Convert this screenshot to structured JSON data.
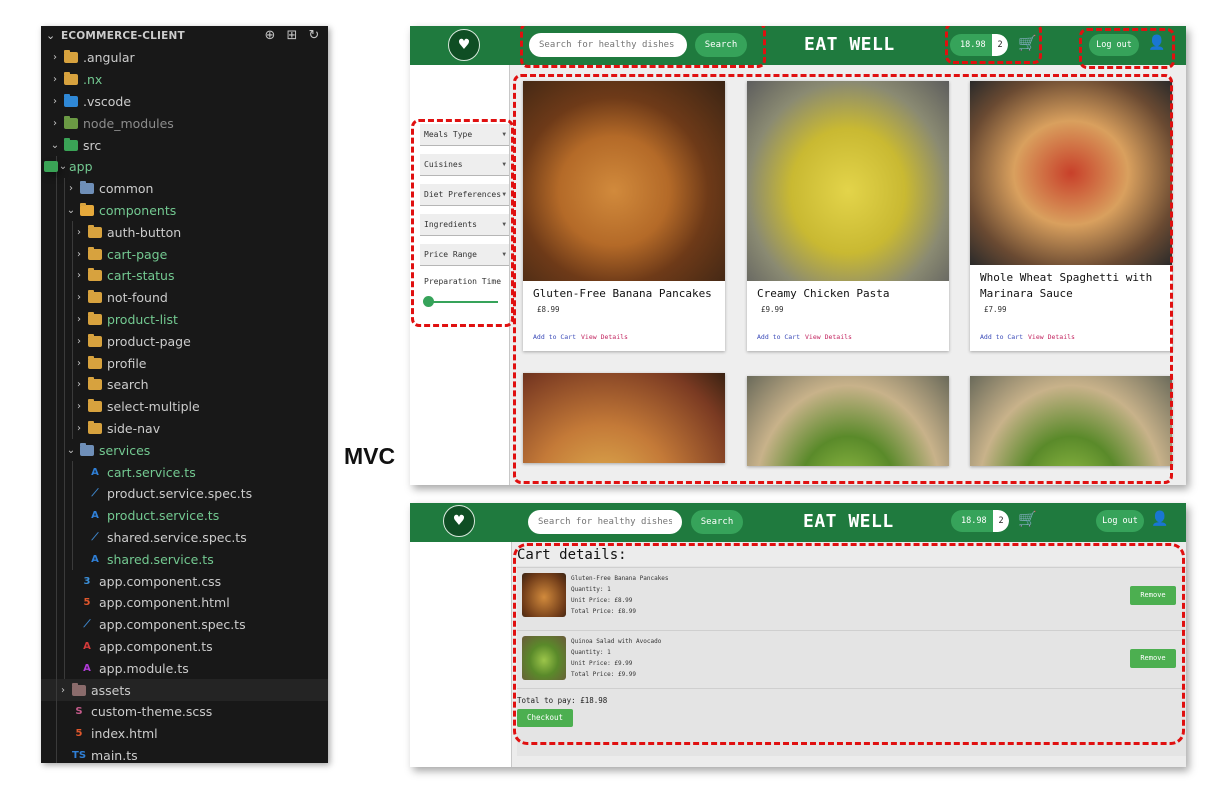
{
  "explorer": {
    "title": "ECOMMERCE-CLIENT",
    "actions": [
      "new-file-icon",
      "new-folder-icon",
      "refresh-icon"
    ],
    "items": [
      {
        "label": ".angular",
        "color": "#cccccc"
      },
      {
        "label": ".nx",
        "color": "#73c991"
      },
      {
        "label": ".vscode",
        "color": "#cccccc"
      },
      {
        "label": "node_modules",
        "color": "#8c8c8c"
      },
      {
        "label": "src",
        "color": "#cccccc"
      },
      {
        "label": "app",
        "color": "#73c991"
      },
      {
        "label": "common",
        "color": "#cccccc"
      },
      {
        "label": "components",
        "color": "#73c991"
      },
      {
        "label": "auth-button",
        "color": "#cccccc"
      },
      {
        "label": "cart-page",
        "color": "#73c991"
      },
      {
        "label": "cart-status",
        "color": "#73c991"
      },
      {
        "label": "not-found",
        "color": "#cccccc"
      },
      {
        "label": "product-list",
        "color": "#73c991"
      },
      {
        "label": "product-page",
        "color": "#cccccc"
      },
      {
        "label": "profile",
        "color": "#cccccc"
      },
      {
        "label": "search",
        "color": "#cccccc"
      },
      {
        "label": "select-multiple",
        "color": "#cccccc"
      },
      {
        "label": "side-nav",
        "color": "#cccccc"
      },
      {
        "label": "services",
        "color": "#73c991"
      },
      {
        "label": "cart.service.ts",
        "color": "#73c991"
      },
      {
        "label": "product.service.spec.ts",
        "color": "#cccccc"
      },
      {
        "label": "product.service.ts",
        "color": "#73c991"
      },
      {
        "label": "shared.service.spec.ts",
        "color": "#cccccc"
      },
      {
        "label": "shared.service.ts",
        "color": "#73c991"
      },
      {
        "label": "app.component.css",
        "color": "#cccccc"
      },
      {
        "label": "app.component.html",
        "color": "#cccccc"
      },
      {
        "label": "app.component.spec.ts",
        "color": "#cccccc"
      },
      {
        "label": "app.component.ts",
        "color": "#cccccc"
      },
      {
        "label": "app.module.ts",
        "color": "#cccccc"
      },
      {
        "label": "assets",
        "color": "#cccccc"
      },
      {
        "label": "custom-theme.scss",
        "color": "#cccccc"
      },
      {
        "label": "index.html",
        "color": "#cccccc"
      },
      {
        "label": "main.ts",
        "color": "#cccccc"
      }
    ]
  },
  "mvc_label": "MVC",
  "app": {
    "brand": "EAT WELL",
    "search_placeholder": "Search for healthy dishes ...",
    "search_button": "Search",
    "cart_total": "18.98",
    "cart_count": "2",
    "logout": "Log out",
    "accent": "#1f7a3e"
  },
  "filters": [
    "Meals Type",
    "Cuisines",
    "Diet Preferences",
    "Ingredients",
    "Price Range"
  ],
  "slider_label": "Preparation Time",
  "products": [
    {
      "title": "Gluten-Free Banana Pancakes",
      "price": "£8.99",
      "add": "Add to Cart",
      "view": "View Details"
    },
    {
      "title": "Creamy Chicken Pasta",
      "price": "£9.99",
      "add": "Add to Cart",
      "view": "View Details"
    },
    {
      "title": "Whole Wheat Spaghetti with Marinara Sauce",
      "price": "£7.99",
      "add": "Add to Cart",
      "view": "View Details"
    }
  ],
  "cart": {
    "heading": "Cart details:",
    "items": [
      {
        "name": "Gluten-Free Banana Pancakes",
        "quantity": "Quantity: 1",
        "unit": "Unit Price: £8.99",
        "total": "Total Price: £8.99",
        "remove": "Remove"
      },
      {
        "name": "Quinoa Salad with Avocado",
        "quantity": "Quantity: 1",
        "unit": "Unit Price: £9.99",
        "total": "Total Price: £9.99",
        "remove": "Remove"
      }
    ],
    "total_line": "Total to pay: £18.98",
    "checkout": "Checkout"
  }
}
